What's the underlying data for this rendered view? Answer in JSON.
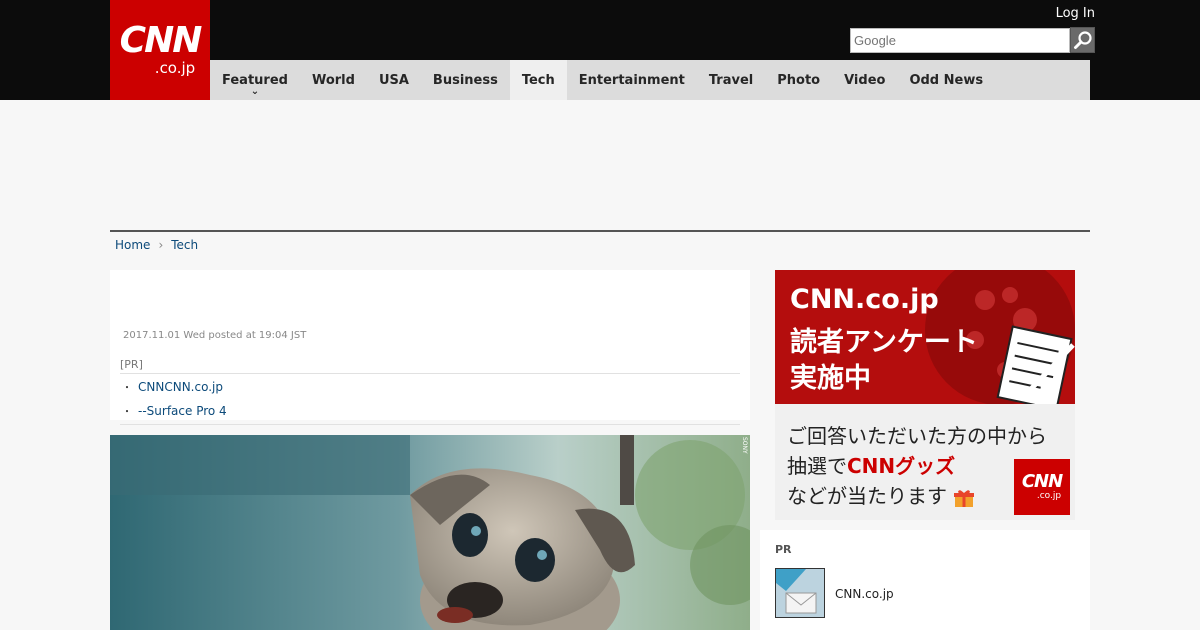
{
  "header": {
    "logo_main": "CNN",
    "logo_sub": ".co.jp",
    "login_label": "Log In",
    "search_placeholder": "Google",
    "search_icon": "magnifier-icon"
  },
  "nav": {
    "items": [
      {
        "label": "Featured",
        "has_dropdown": true
      },
      {
        "label": "World"
      },
      {
        "label": "USA"
      },
      {
        "label": "Business"
      },
      {
        "label": "Tech",
        "active": true
      },
      {
        "label": "Entertainment"
      },
      {
        "label": "Travel"
      },
      {
        "label": "Photo"
      },
      {
        "label": "Video"
      },
      {
        "label": "Odd News"
      }
    ]
  },
  "breadcrumb": {
    "home": "Home",
    "current": "Tech"
  },
  "article": {
    "date": "2017.11.01 Wed posted at 19:04 JST",
    "pr_label": "[PR]",
    "pr_links": [
      "CNNCNN.co.jp",
      "--Surface Pro 4"
    ],
    "photo_credit": "SONY"
  },
  "sidebar": {
    "ad_line1": "CNN.co.jp",
    "ad_line2": "読者アンケート",
    "ad_line3": "実施中",
    "ad_sub1": "ご回答いただいた方の中から",
    "ad_sub2_pre": "抽選で",
    "ad_sub2_red": "CNNグッズ",
    "ad_sub3": "などが当たります",
    "ad_logo_main": "CNN",
    "ad_logo_sub": ".co.jp",
    "pr_label": "PR",
    "pr_item": "CNN.co.jp"
  },
  "colors": {
    "brand_red": "#cc0000",
    "topbar": "#0c0c0c",
    "nav_bg": "#dcdcdc",
    "link": "#0c4a7a"
  }
}
